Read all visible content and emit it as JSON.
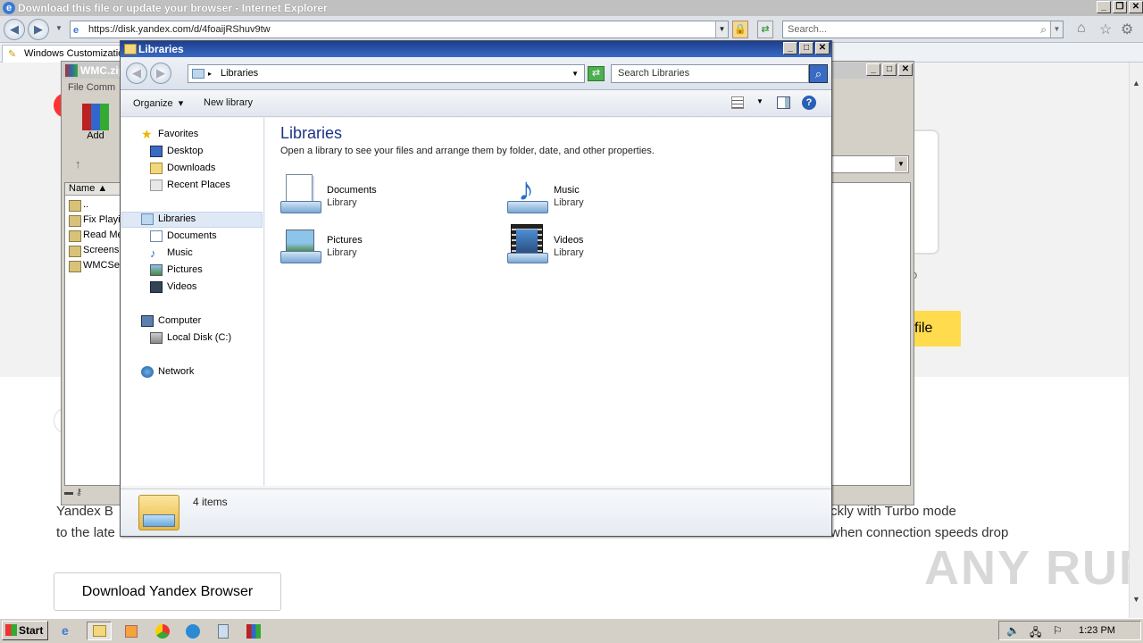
{
  "browser": {
    "title": "Download this file or update your browser - Internet Explorer",
    "url": "https://disk.yandex.com/d/4foaijRShuv9tw",
    "search_placeholder": "Search...",
    "tab_label": "Windows Customizatio"
  },
  "webpage": {
    "desc_line1_left": "Yandex B",
    "desc_line1_right": "ckly with Turbo mode",
    "desc_line2_left": "to the late",
    "desc_line2_right": "when connection speeds drop",
    "download_button": "Download Yandex Browser",
    "file_button": "file",
    "watermark": "ANY RUN"
  },
  "winrar": {
    "title": "WMC.zip",
    "menu": "File  Comm",
    "add_label": "Add",
    "column_name": "Name",
    "items": [
      "..",
      "Fix Playi",
      "Read Me",
      "Screensl",
      "WMCSet"
    ]
  },
  "explorer": {
    "title": "Libraries",
    "address": "Libraries",
    "search_placeholder": "Search Libraries",
    "commands": {
      "organize": "Organize",
      "new_library": "New library"
    },
    "nav": {
      "favorites": "Favorites",
      "desktop": "Desktop",
      "downloads": "Downloads",
      "recent": "Recent Places",
      "libraries": "Libraries",
      "documents": "Documents",
      "music": "Music",
      "pictures": "Pictures",
      "videos": "Videos",
      "computer": "Computer",
      "local_disk": "Local Disk (C:)",
      "network": "Network"
    },
    "heading": "Libraries",
    "subheading": "Open a library to see your files and arrange them by folder, date, and other properties.",
    "libraries": [
      {
        "name": "Documents",
        "type": "Library"
      },
      {
        "name": "Music",
        "type": "Library"
      },
      {
        "name": "Pictures",
        "type": "Library"
      },
      {
        "name": "Videos",
        "type": "Library"
      }
    ],
    "status": "4 items"
  },
  "taskbar": {
    "start": "Start",
    "clock": "1:23 PM"
  }
}
